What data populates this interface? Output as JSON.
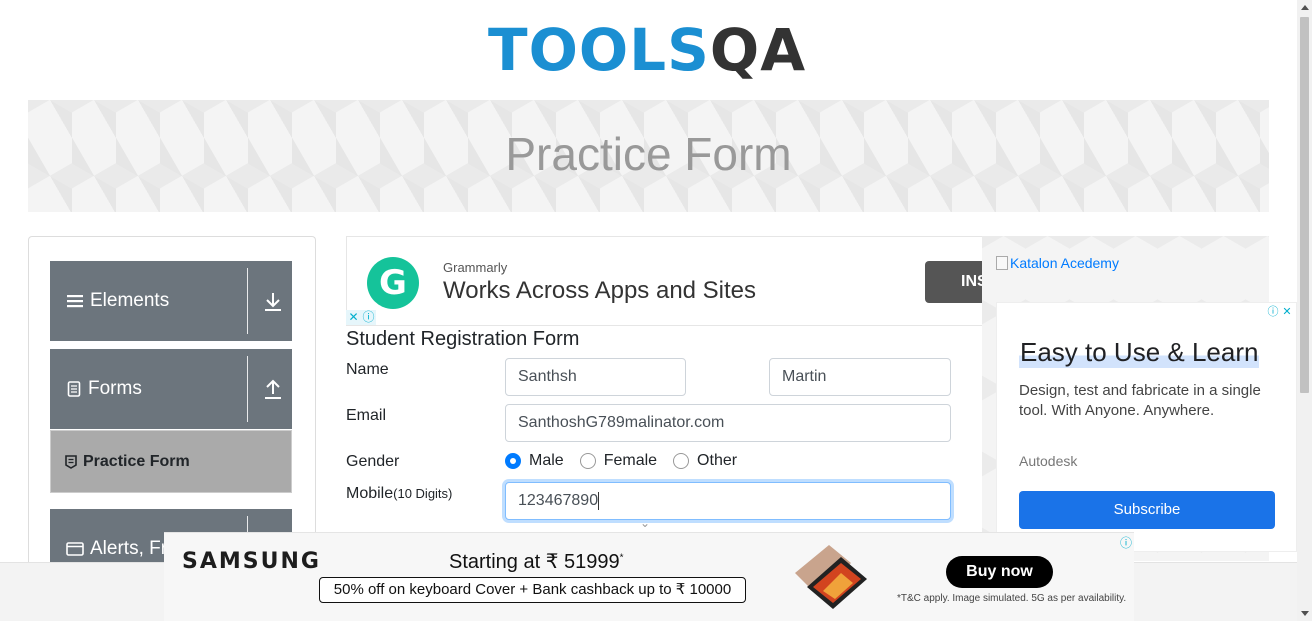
{
  "logo": {
    "left": "TOOLS",
    "right": "QA"
  },
  "banner": {
    "title": "Practice Form"
  },
  "sidebar": {
    "groups": [
      {
        "label": "Elements",
        "icon": "menu-icon",
        "arrow": "download-arrow-icon"
      },
      {
        "label": "Forms",
        "icon": "document-icon",
        "arrow": "upload-arrow-icon"
      },
      {
        "label": "Alerts, Fr",
        "icon": "window-icon",
        "arrow": "download-arrow-icon"
      }
    ],
    "active_item": {
      "label": "Practice Form",
      "icon": "form-icon"
    }
  },
  "ad_top": {
    "brand": "Grammarly",
    "headline": "Works Across Apps and Sites",
    "button": "INS",
    "logo_letter": "G"
  },
  "form": {
    "title": "Student Registration Form",
    "name_label": "Name",
    "first_name": "Santhsh",
    "last_name": "Martin",
    "email_label": "Email",
    "email": "SanthoshG789malinator.com",
    "gender_label": "Gender",
    "genders": [
      "Male",
      "Female",
      "Other"
    ],
    "gender_selected": "Male",
    "mobile_label": "Mobile",
    "mobile_hint": "(10 Digits)",
    "mobile": "123467890"
  },
  "ad_right": {
    "image_alt": "Katalon Acedemy",
    "headline": "Easy to Use & Learn",
    "body": "Design, test and fabricate in a single tool. With Anyone. Anywhere.",
    "brand": "Autodesk",
    "button": "Subscribe"
  },
  "ad_bottom": {
    "brand": "SAMSUNG",
    "headline": "Starting at ₹ 51999",
    "headline_mark": "*",
    "offer": "50% off on keyboard Cover + Bank cashback up to ₹ 10000",
    "button": "Buy now",
    "terms": "*T&C apply. Image simulated. 5G as per availability."
  },
  "colors": {
    "accent": "#007bff",
    "sidebar_group": "#6c757d",
    "logo_blue": "#1b8fd2"
  }
}
